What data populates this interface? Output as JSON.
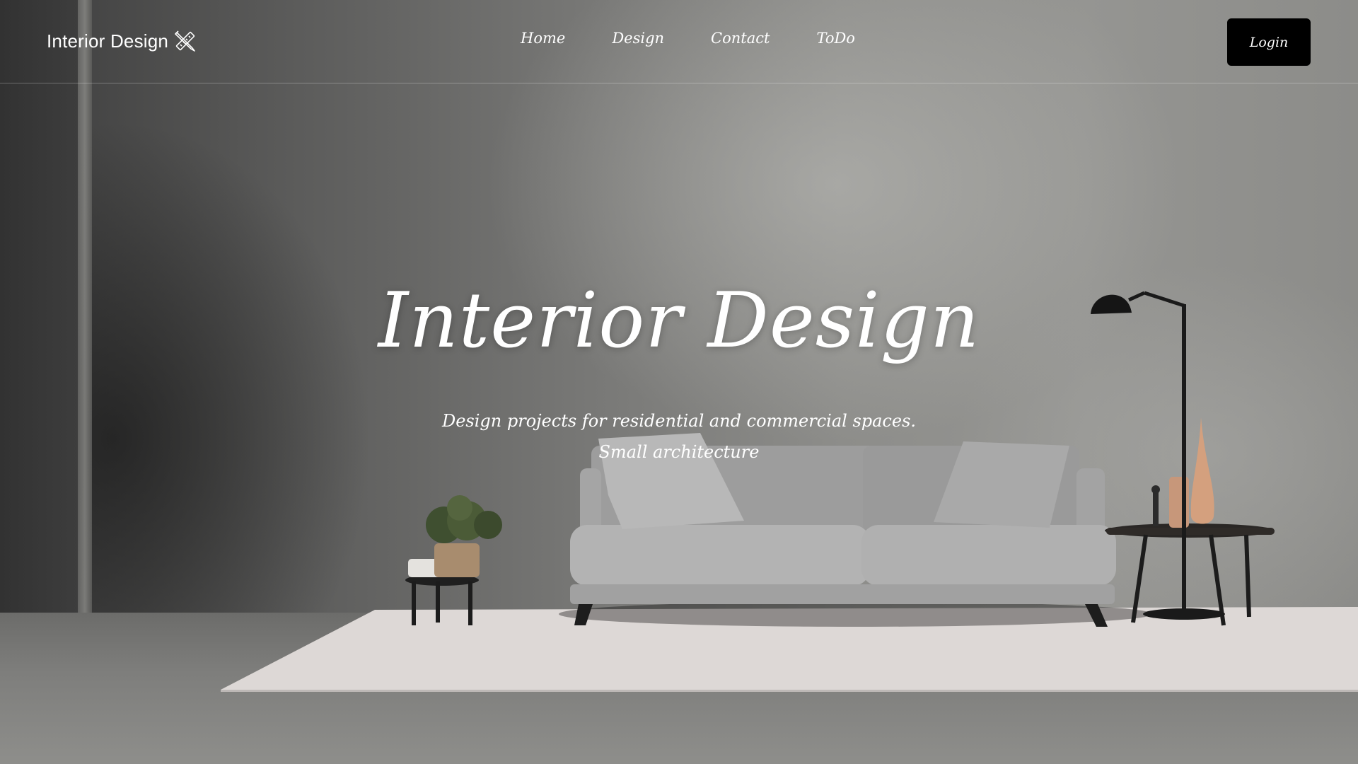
{
  "app": {
    "brand": "Interior Design",
    "brand_icon": "pencil-ruler-icon"
  },
  "nav": {
    "items": [
      {
        "label": "Home"
      },
      {
        "label": "Design"
      },
      {
        "label": "Contact"
      },
      {
        "label": "ToDo"
      }
    ],
    "login_label": "Login"
  },
  "hero": {
    "title": "Interior Design",
    "subtitle_line1": "Design projects for residential and commercial spaces.",
    "subtitle_line2": "Small architecture",
    "background_image": "living-room-with-grey-sofa-floor-lamp-side-tables-plant"
  },
  "colors": {
    "text": "#ffffff",
    "login_bg": "#000000",
    "wall": "#8d8d8a",
    "floor": "#7e7e7c",
    "rug": "#ddd8d6",
    "sofa": "#a7a7a7"
  }
}
